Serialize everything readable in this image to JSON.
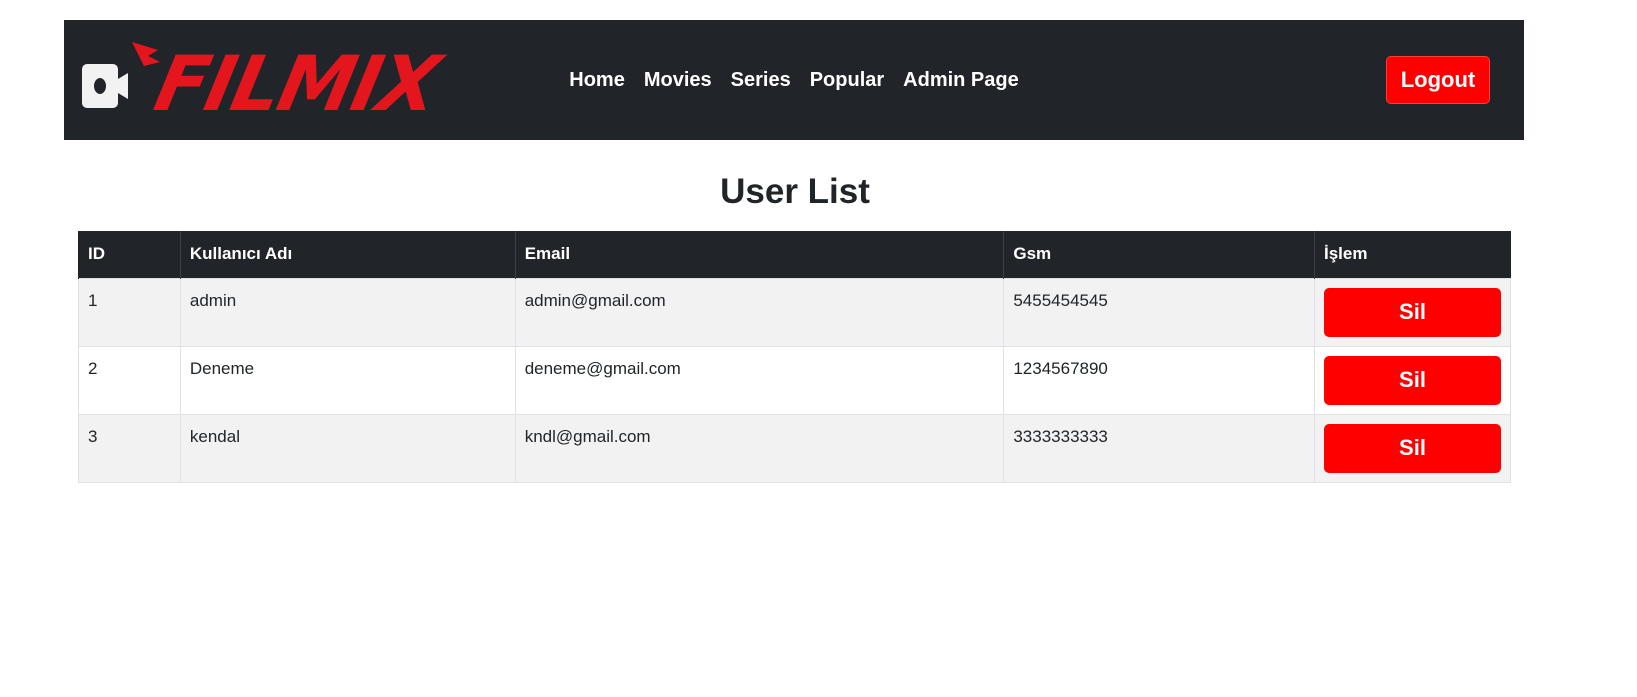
{
  "navbar": {
    "brand_text": "FILMIX",
    "brand_color": "#e3161e",
    "background": "#212529",
    "links": [
      {
        "label": "Home"
      },
      {
        "label": "Movies"
      },
      {
        "label": "Series"
      },
      {
        "label": "Popular"
      },
      {
        "label": "Admin Page"
      }
    ],
    "logout_label": "Logout"
  },
  "page": {
    "title": "User List"
  },
  "table": {
    "headers": {
      "id": "ID",
      "username": "Kullanıcı Adı",
      "email": "Email",
      "gsm": "Gsm",
      "action": "İşlem"
    },
    "rows": [
      {
        "id": "1",
        "username": "admin",
        "email": "admin@gmail.com",
        "gsm": "5455454545",
        "action_label": "Sil"
      },
      {
        "id": "2",
        "username": "Deneme",
        "email": "deneme@gmail.com",
        "gsm": "1234567890",
        "action_label": "Sil"
      },
      {
        "id": "3",
        "username": "kendal",
        "email": "kndl@gmail.com",
        "gsm": "3333333333",
        "action_label": "Sil"
      }
    ]
  },
  "colors": {
    "accent_red": "#ff0000",
    "header_dark": "#212529"
  },
  "icons": {
    "brand_logo": "video-camera-icon"
  }
}
